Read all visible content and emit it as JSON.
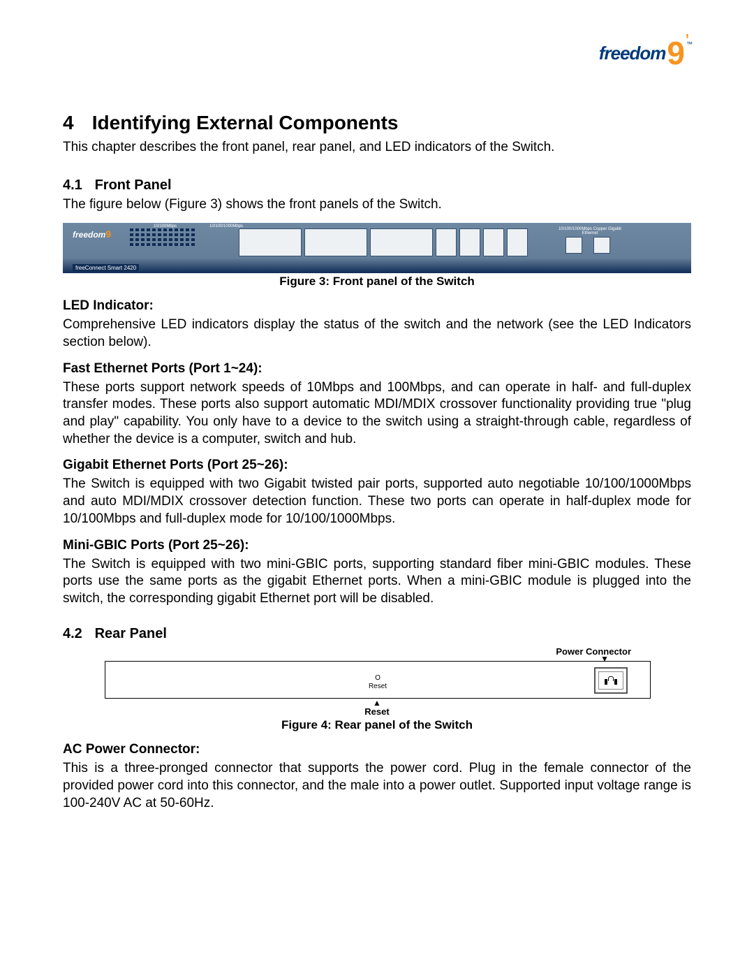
{
  "logo": {
    "brand": "freedom",
    "nine": "9",
    "tm": "™"
  },
  "chapter": {
    "num": "4",
    "title": "Identifying External Components"
  },
  "intro": "This chapter describes the front panel, rear panel, and LED indicators of the Switch.",
  "sec1": {
    "num": "4.1",
    "title": "Front Panel",
    "lead": "The figure below (Figure 3) shows the front panels of the Switch.",
    "caption": "Figure 3: Front panel of the Switch",
    "fp_model": "freeConnect Smart 2420",
    "fp_led_label_top": "10/100Mbps",
    "fp_led_label_right": "10/100/1000Mbps",
    "fp_gig_label": "10/100/1000Mbps\nCopper Gigabit Ethernet",
    "led": {
      "heading": "LED Indicator:",
      "text": "Comprehensive LED indicators display the status of the switch and the network (see the LED Indicators section below)."
    },
    "fe": {
      "heading": "Fast Ethernet Ports (Port 1~24):",
      "text": "These ports support network speeds of 10Mbps and 100Mbps, and can operate in half- and full-duplex transfer modes. These ports also support automatic MDI/MDIX crossover functionality providing true \"plug and play\" capability.  You only have to a device to the switch using a straight-through cable, regardless of whether the device is a computer, switch and hub."
    },
    "ge": {
      "heading": "Gigabit Ethernet Ports (Port 25~26):",
      "text": "The Switch is equipped with two Gigabit twisted pair ports, supported auto negotiable 10/100/1000Mbps and auto MDI/MDIX crossover detection function. These two ports can operate in half-duplex mode for 10/100Mbps and full-duplex mode for 10/100/1000Mbps."
    },
    "gbic": {
      "heading": "Mini-GBIC Ports (Port 25~26):",
      "text": "The Switch is equipped with two mini-GBIC ports, supporting standard fiber mini-GBIC modules. These ports use the same ports as the gigabit Ethernet ports.  When a mini-GBIC module is plugged into the switch, the corresponding gigabit Ethernet port will be disabled."
    }
  },
  "sec2": {
    "num": "4.2",
    "title": "Rear Panel",
    "label_power": "Power Connector",
    "reset_o": "O",
    "reset_txt": "Reset",
    "label_reset_below": "Reset",
    "caption": "Figure 4: Rear panel of the Switch",
    "ac": {
      "heading": "AC Power Connector:",
      "text": "This is a three-pronged connector that supports the power cord. Plug in the female connector of the provided power cord into this connector, and the male into a power outlet. Supported input voltage range is 100-240V AC at 50-60Hz."
    }
  }
}
